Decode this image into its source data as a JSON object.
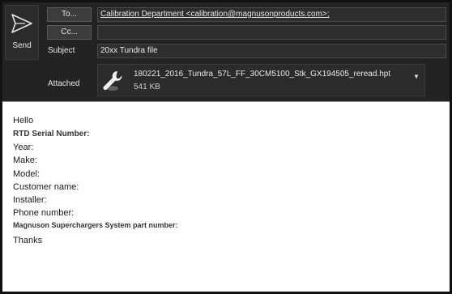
{
  "compose": {
    "send_label": "Send",
    "to_button": "To...",
    "cc_button": "Cc...",
    "to_value": "Calibration Department <calibration@magnusonproducts.com>;",
    "cc_value": "",
    "subject_label": "Subject",
    "subject_value": "20xx Tundra file",
    "attached_label": "Attached",
    "attachment": {
      "name": "180221_2016_Tundra_57L_FF_30CM5100_Stk_GX194505_reread.hpt",
      "size": "541 KB",
      "icon": "wrench-icon"
    }
  },
  "body": {
    "greeting": "Hello",
    "rtd_serial": "RTD Serial Number:",
    "year": "Year:",
    "make": "Make:",
    "model": "Model:",
    "customer_name": "Customer name:",
    "installer": "Installer:",
    "phone_number": "Phone number:",
    "part_number": "Magnuson Superchargers System part number:",
    "closing": "Thanks"
  },
  "colors": {
    "header_bg": "#232323",
    "body_bg": "#ffffff",
    "text_light": "#e8e8e8"
  }
}
